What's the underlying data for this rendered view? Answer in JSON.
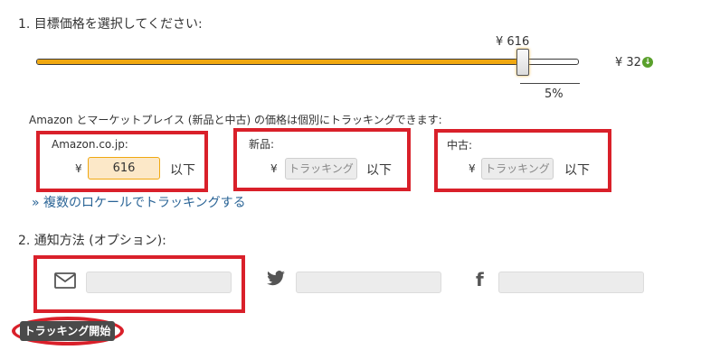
{
  "step1": {
    "title": "1. 目標価格を選択してください:",
    "slider": {
      "value_label": "¥ 616",
      "level_fraction": 0.895,
      "low_price": "¥ 32",
      "percent": "5%"
    },
    "tracking_info": "Amazon とマーケットプレイス (新品と中古) の価格は個別にトラッキングできます:",
    "amazon": {
      "label": "Amazon.co.jp:",
      "currency": "¥",
      "value": "616",
      "suffix": "以下"
    },
    "new": {
      "label": "新品:",
      "currency": "¥",
      "placeholder": "トラッキング",
      "suffix": "以下"
    },
    "used": {
      "label": "中古:",
      "currency": "¥",
      "placeholder": "トラッキング",
      "suffix": "以下"
    },
    "locale_link": "» 複数のロケールでトラッキングする"
  },
  "step2": {
    "title": "2. 通知方法 (オプション):",
    "icons": [
      "mail-icon",
      "twitter-icon",
      "facebook-icon"
    ]
  },
  "start_button": "トラッキング開始",
  "colors": {
    "accent": "#f0a810",
    "highlight_red": "#d9202a",
    "link": "#2a6496",
    "drop_green": "#5aa02c"
  }
}
